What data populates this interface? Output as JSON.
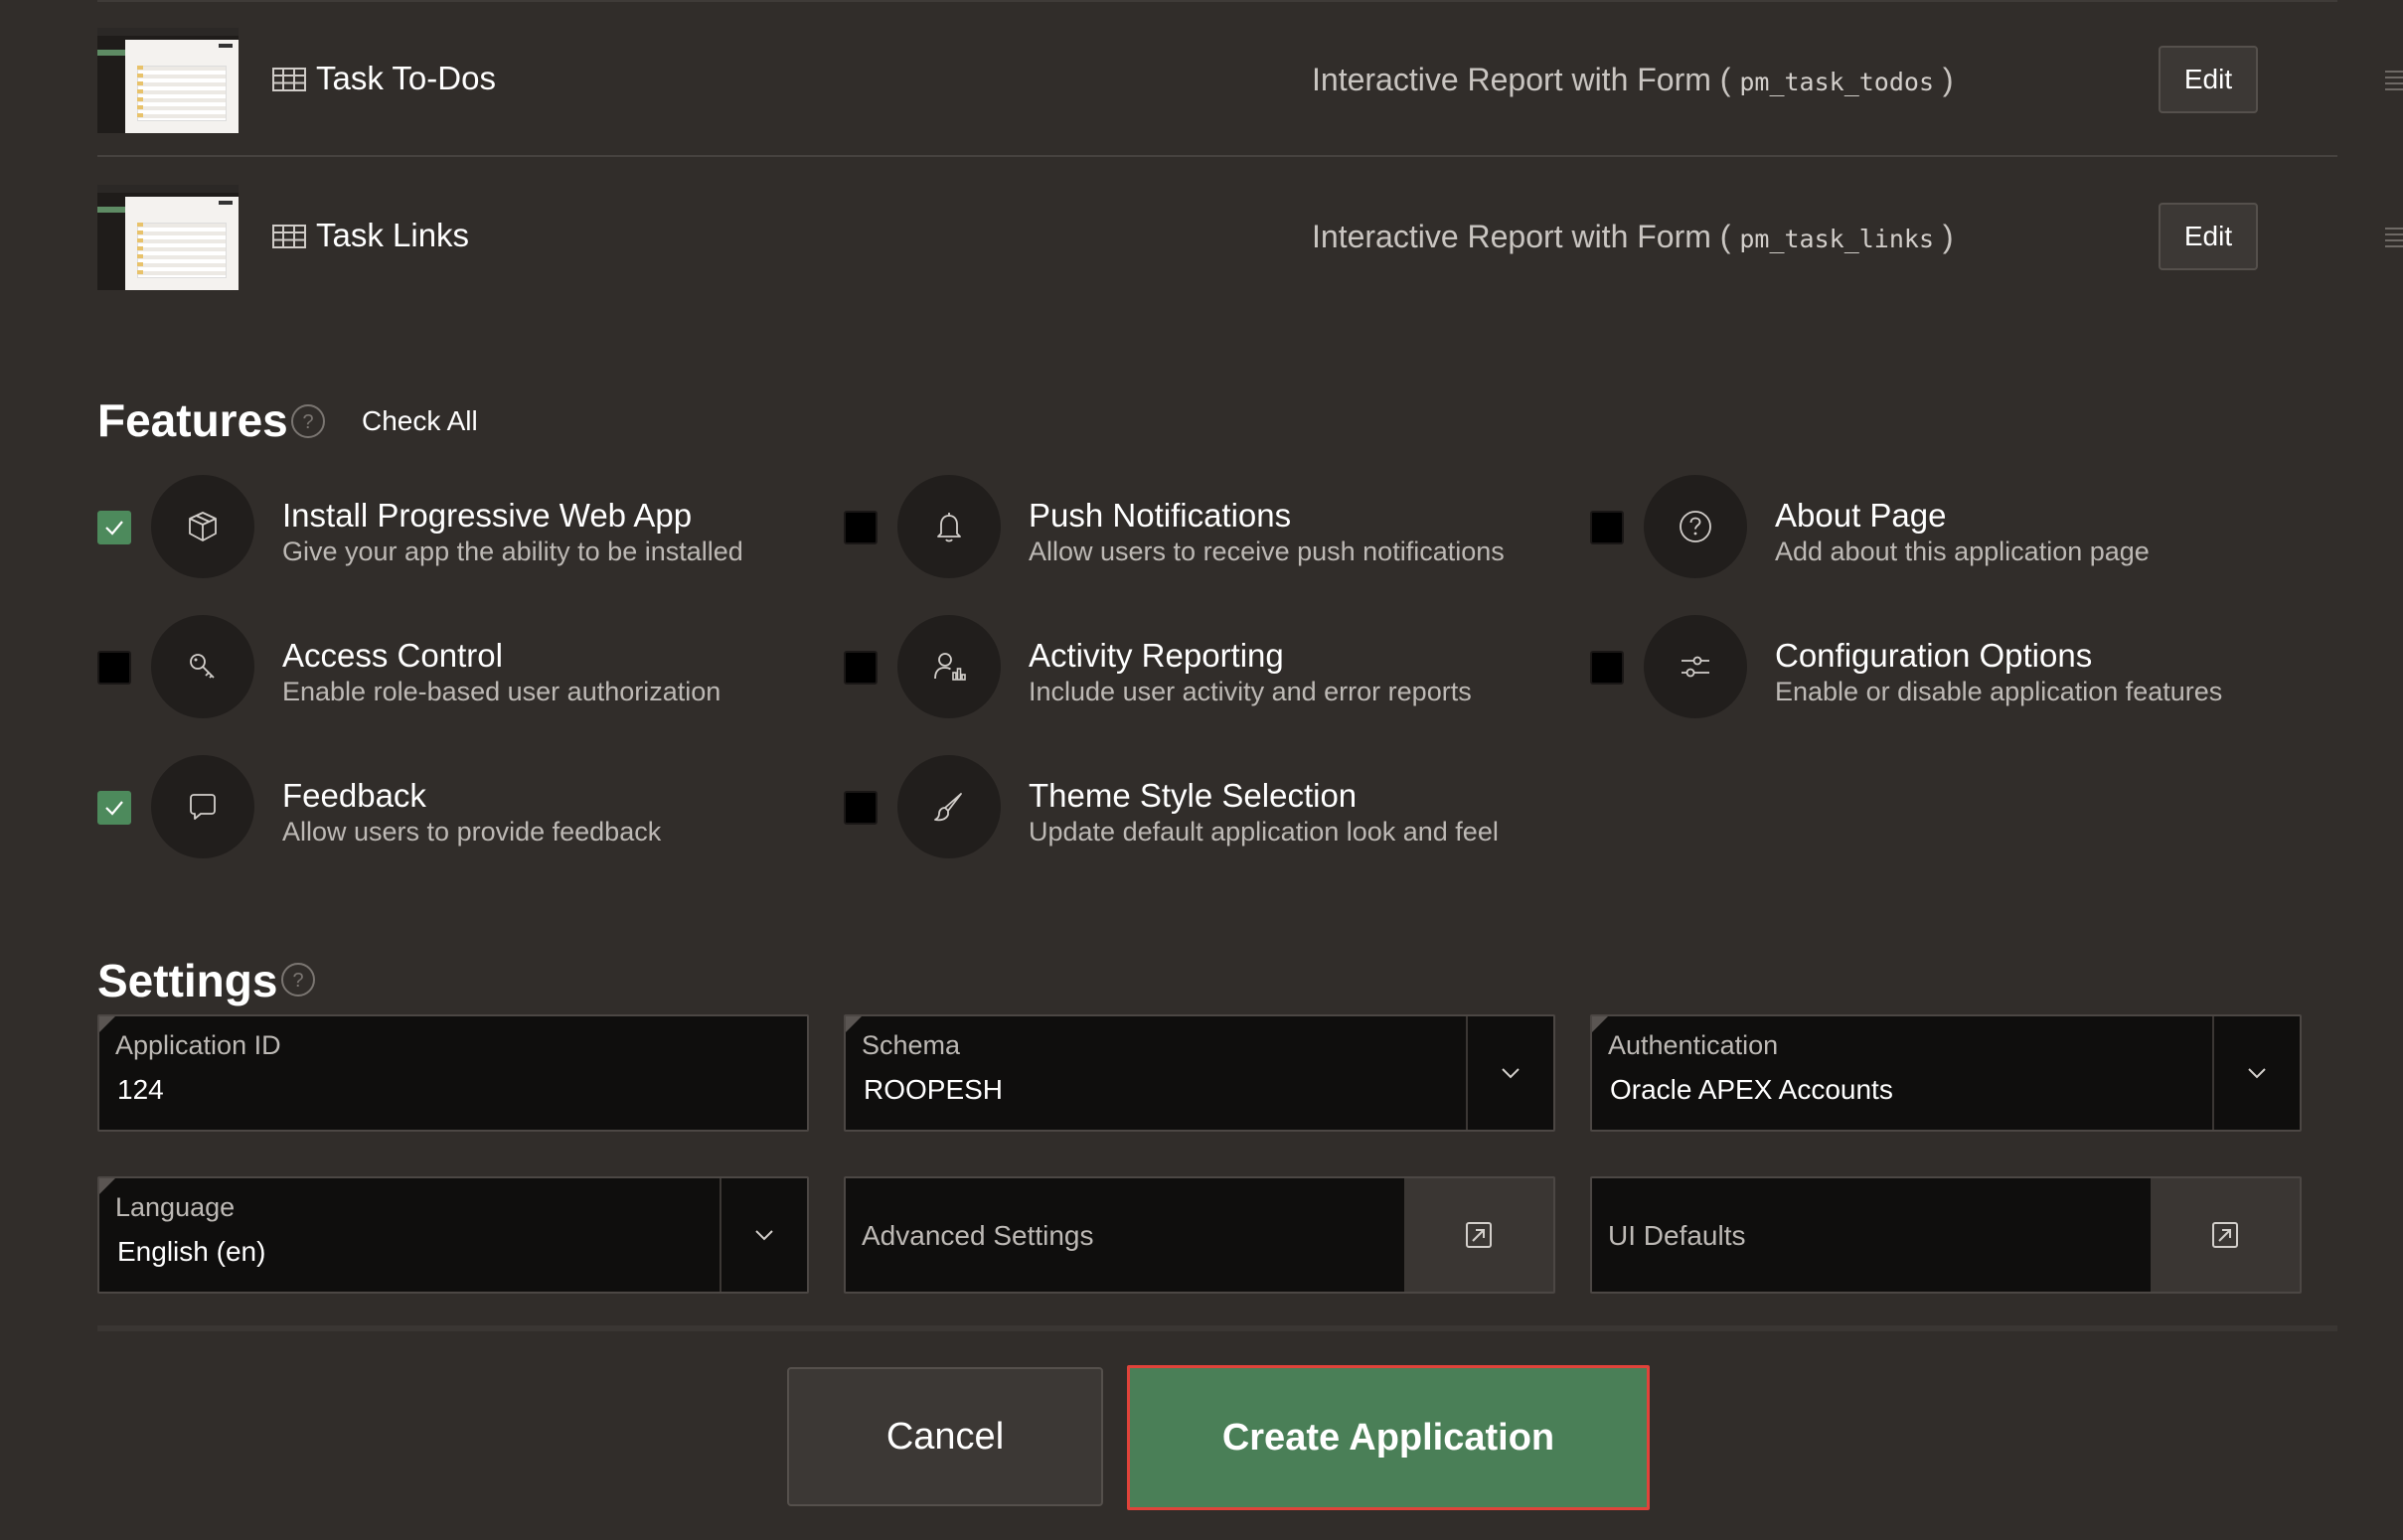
{
  "pages": [
    {
      "title": "Task To-Dos",
      "type_prefix": "Interactive Report with Form ( ",
      "table": "pm_task_todos",
      "type_suffix": " )",
      "edit_label": "Edit"
    },
    {
      "title": "Task Links",
      "type_prefix": "Interactive Report with Form ( ",
      "table": "pm_task_links",
      "type_suffix": " )",
      "edit_label": "Edit"
    }
  ],
  "features": {
    "heading": "Features",
    "check_all_label": "Check All",
    "items": [
      {
        "title": "Install Progressive Web App",
        "description": "Give your app the ability to be installed",
        "checked": true,
        "icon": "package-icon"
      },
      {
        "title": "Push Notifications",
        "description": "Allow users to receive push notifications",
        "checked": false,
        "icon": "bell-icon"
      },
      {
        "title": "About Page",
        "description": "Add about this application page",
        "checked": false,
        "icon": "question-circle-icon"
      },
      {
        "title": "Access Control",
        "description": "Enable role-based user authorization",
        "checked": false,
        "icon": "key-icon"
      },
      {
        "title": "Activity Reporting",
        "description": "Include user activity and error reports",
        "checked": false,
        "icon": "user-chart-icon"
      },
      {
        "title": "Configuration Options",
        "description": "Enable or disable application features",
        "checked": false,
        "icon": "sliders-icon"
      },
      {
        "title": "Feedback",
        "description": "Allow users to provide feedback",
        "checked": true,
        "icon": "speech-bubble-icon"
      },
      {
        "title": "Theme Style Selection",
        "description": "Update default application look and feel",
        "checked": false,
        "icon": "paintbrush-icon"
      }
    ]
  },
  "settings": {
    "heading": "Settings",
    "application_id": {
      "label": "Application ID",
      "value": "124"
    },
    "schema": {
      "label": "Schema",
      "value": "ROOPESH"
    },
    "authentication": {
      "label": "Authentication",
      "value": "Oracle APEX Accounts"
    },
    "language": {
      "label": "Language",
      "value": "English (en)"
    },
    "advanced_settings": {
      "label": "Advanced Settings"
    },
    "ui_defaults": {
      "label": "UI Defaults"
    }
  },
  "actions": {
    "cancel_label": "Cancel",
    "create_label": "Create Application"
  },
  "colors": {
    "background": "#312d2a",
    "checkbox_checked": "#4d8a5c",
    "create_button": "#4a7f57",
    "create_button_focus_border": "#e0433a"
  }
}
